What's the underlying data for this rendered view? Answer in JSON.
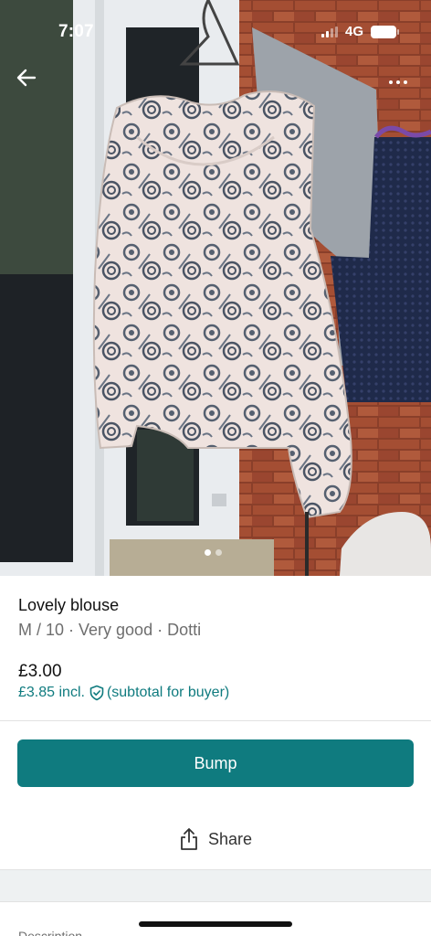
{
  "status_bar": {
    "time": "7:07",
    "network": "4G"
  },
  "photo": {
    "image_count": 2,
    "active_index": 0
  },
  "listing": {
    "title": "Lovely blouse",
    "subtitle": "M / 10 · Very good · Dotti",
    "price": "£3.00",
    "price_incl": "£3.85 incl.",
    "price_incl_note": "(subtotal for buyer)"
  },
  "actions": {
    "bump_label": "Bump",
    "share_label": "Share"
  },
  "sections": {
    "description_label": "Description"
  },
  "colors": {
    "accent": "#0f7b7f",
    "muted_text": "#6e6e6e",
    "section_band": "#eef1f2"
  }
}
